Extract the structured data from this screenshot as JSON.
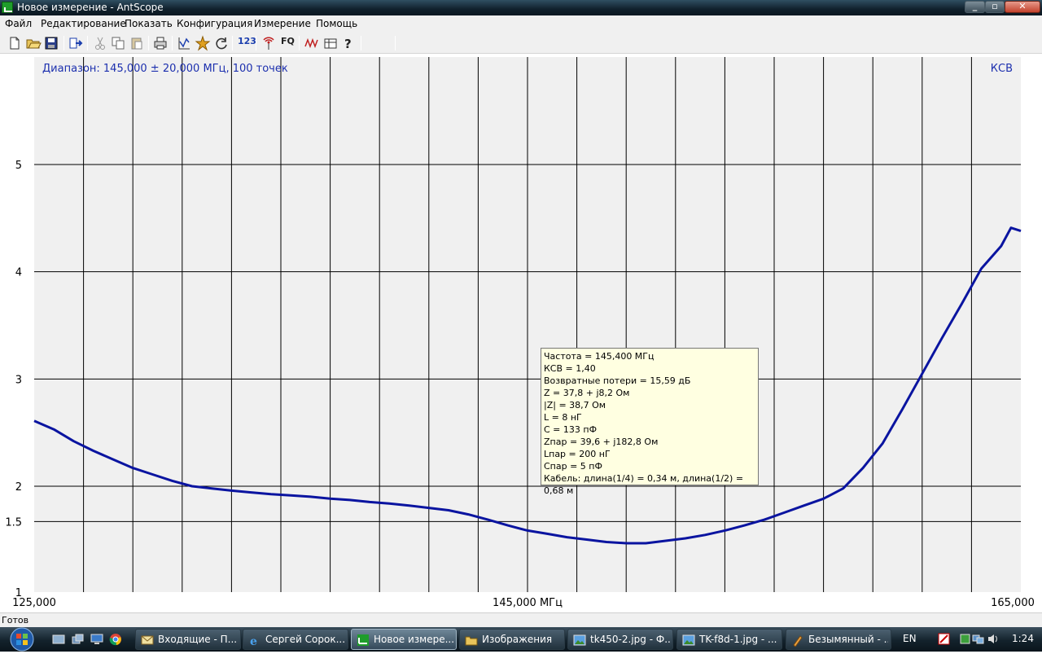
{
  "window": {
    "title": "Новое измерение - AntScope"
  },
  "menu": [
    "Файл",
    "Редактирование",
    "Показать",
    "Конфигурация",
    "Измерение",
    "Помощь"
  ],
  "toolbar": {
    "icons": [
      "new-file-icon",
      "open-folder-icon",
      "save-icon",
      "export-icon",
      "cut-icon",
      "copy-icon",
      "paste-icon",
      "print-icon",
      "chart-axes-icon",
      "star-burst-icon",
      "refresh-icon",
      "123-icon",
      "antenna-icon",
      "fq-icon",
      "waveform-icon",
      "table-icon",
      "help-icon"
    ],
    "numbers_label": "123",
    "fq_label": "FQ"
  },
  "plot": {
    "range_label": "Диапазон: 145,000 ± 20,000 МГц, 100 точек",
    "mode_label": "КСВ",
    "x_tick_left": "125,000",
    "x_tick_center": "145,000 МГц",
    "x_tick_right": "165,000",
    "y_ticks": [
      "5",
      "4",
      "3",
      "2",
      "1.5",
      "1"
    ],
    "colors": {
      "curve": "#0a14a0",
      "grid": "#000000",
      "bg": "#f0f0f0",
      "text": "#1c2fae"
    }
  },
  "chart_data": {
    "type": "line",
    "xlabel": "МГц",
    "ylabel": "КСВ",
    "xlim": [
      125.0,
      165.0
    ],
    "ylim": [
      1.0,
      5.0
    ],
    "cursor_x": 145.0,
    "series": [
      {
        "x": [
          125.0,
          125.8,
          126.6,
          127.4,
          128.2,
          129.0,
          129.8,
          130.6,
          131.4,
          132.2,
          133.0,
          133.8,
          134.6,
          135.4,
          136.2,
          137.0,
          137.8,
          138.6,
          139.4,
          140.2,
          141.0,
          141.8,
          142.6,
          143.4,
          144.2,
          145.0,
          145.8,
          146.6,
          147.4,
          148.2,
          149.0,
          149.8,
          150.6,
          151.4,
          152.2,
          153.0,
          153.8,
          154.6,
          155.4,
          156.2,
          157.0,
          157.8,
          158.6,
          159.4,
          160.2,
          161.0,
          161.8,
          162.6,
          163.4,
          164.2,
          164.6,
          165.0
        ],
        "values": [
          2.61,
          2.53,
          2.42,
          2.33,
          2.25,
          2.17,
          2.11,
          2.05,
          2.0,
          1.96,
          1.92,
          1.89,
          1.86,
          1.84,
          1.82,
          1.79,
          1.77,
          1.74,
          1.72,
          1.69,
          1.66,
          1.63,
          1.58,
          1.52,
          1.46,
          1.41,
          1.38,
          1.35,
          1.33,
          1.31,
          1.3,
          1.3,
          1.32,
          1.34,
          1.37,
          1.41,
          1.46,
          1.52,
          1.6,
          1.69,
          1.79,
          1.96,
          2.17,
          2.4,
          2.72,
          3.05,
          3.38,
          3.7,
          4.03,
          4.24,
          4.41,
          4.38
        ]
      }
    ]
  },
  "tooltip": {
    "lines": [
      "Частота = 145,400 МГц",
      "КСВ = 1,40",
      "Возвратные потери = 15,59 дБ",
      "Z = 37,8 + j8,2 Ом",
      "|Z| = 38,7 Ом",
      "L = 8 нГ",
      "C = 133 пФ",
      "Zпар = 39,6 + j182,8 Ом",
      "Lпар = 200 нГ",
      "Cпар = 5 пФ",
      "Кабель: длина(1/4) = 0,34 м, длина(1/2) = 0,68 м"
    ]
  },
  "status": "Готов",
  "taskbar": {
    "tasks": [
      {
        "label": "Входящие - П...",
        "icon": "mail-icon"
      },
      {
        "label": "Сергей Сорок...",
        "icon": "ie-icon"
      },
      {
        "label": "Новое измере...",
        "icon": "antscope-icon",
        "active": true
      },
      {
        "label": "Изображения",
        "icon": "folder-icon"
      },
      {
        "label": "tk450-2.jpg - Ф...",
        "icon": "image-viewer-icon"
      },
      {
        "label": "TK-f8d-1.jpg - ...",
        "icon": "image-viewer-icon"
      },
      {
        "label": "Безымянный - ...",
        "icon": "paint-icon"
      }
    ],
    "language": "EN",
    "clock": "1:24"
  }
}
